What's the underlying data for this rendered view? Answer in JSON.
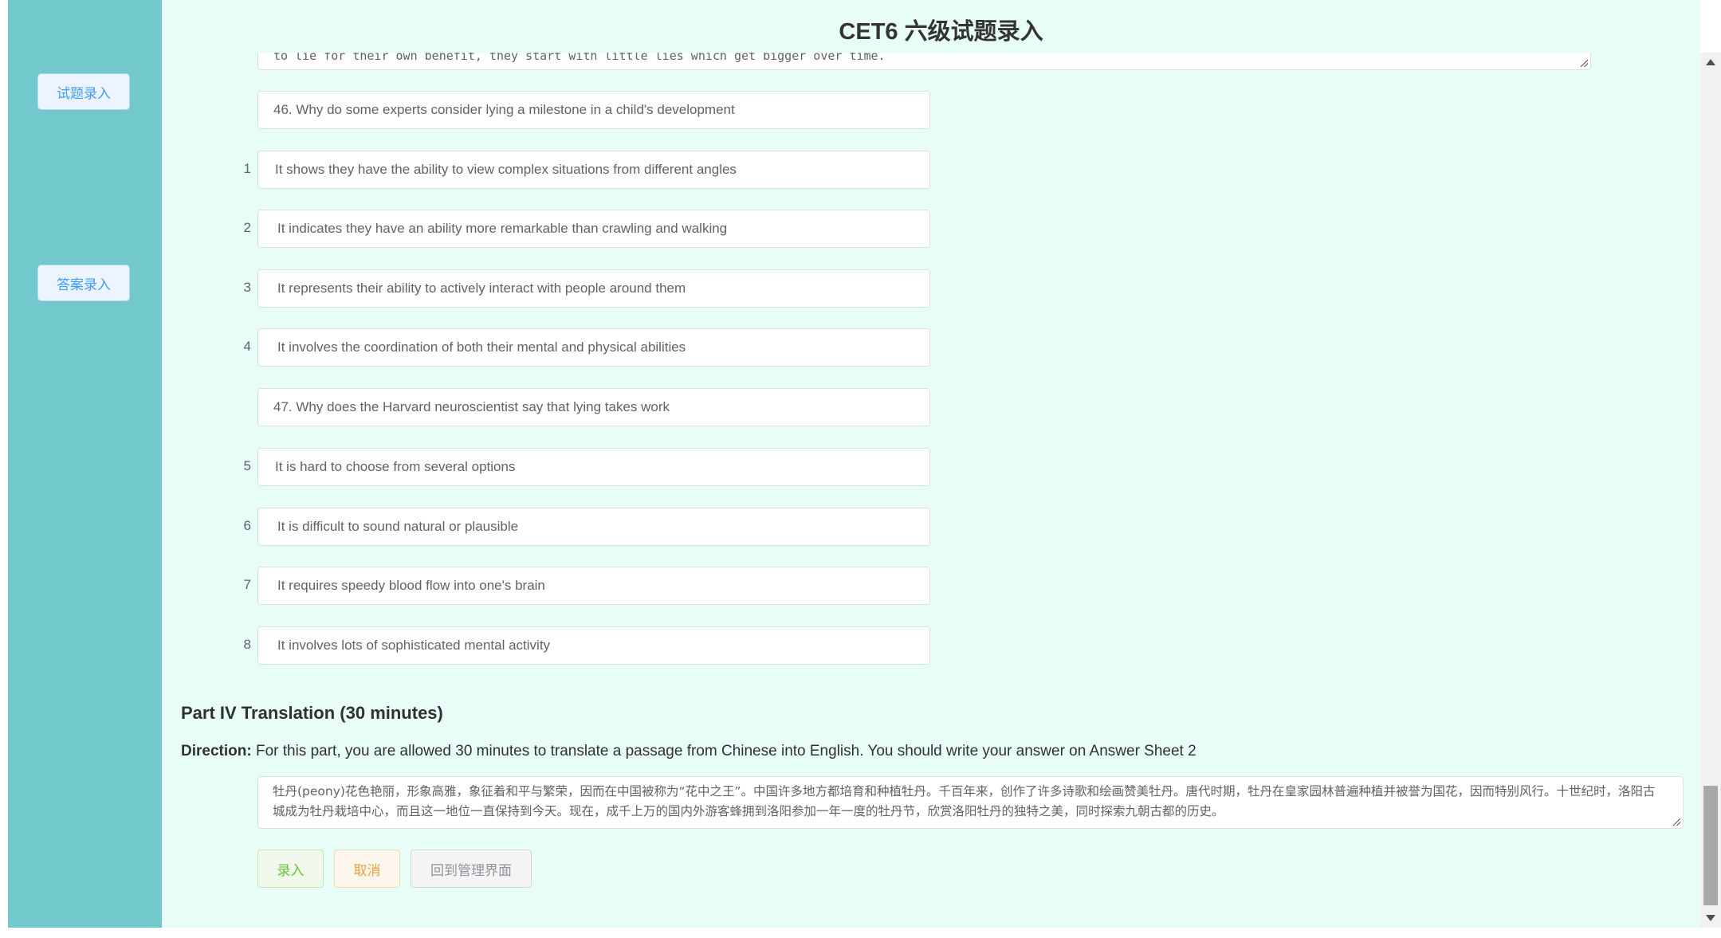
{
  "header": {
    "title": "CET6 六级试题录入"
  },
  "sidebar": {
    "items": [
      {
        "label": "试题录入"
      },
      {
        "label": "答案录入"
      }
    ]
  },
  "passage_textarea": {
    "visible_text": "to lie for their own benefit, they start with little lies which get bigger over time."
  },
  "questions": [
    {
      "question": "46. Why do some experts consider lying a milestone in a child's development",
      "options": [
        {
          "num": "1",
          "text": "It shows they have the ability to view complex situations from different angles"
        },
        {
          "num": "2",
          "text": "It indicates they have an ability more remarkable than crawling and walking"
        },
        {
          "num": "3",
          "text": "It represents their ability to actively interact with people around them"
        },
        {
          "num": "4",
          "text": "It involves the coordination of both their mental and physical abilities"
        }
      ]
    },
    {
      "question": "47. Why does the Harvard neuroscientist say that lying takes work",
      "options": [
        {
          "num": "5",
          "text": "It is hard to choose from several options"
        },
        {
          "num": "6",
          "text": "It is difficult to sound natural or plausible"
        },
        {
          "num": "7",
          "text": "It requires speedy blood flow into one's brain"
        },
        {
          "num": "8",
          "text": "It involves lots of sophisticated mental activity"
        }
      ]
    }
  ],
  "translation": {
    "part_title": "Part IV Translation (30 minutes)",
    "direction_label": "Direction:",
    "direction_text": " For this part, you are allowed 30 minutes to translate a passage from Chinese into English. You should write your answer on Answer Sheet 2",
    "passage": "牡丹(peony)花色艳丽，形象高雅，象征着和平与繁荣，因而在中国被称为“花中之王”。中国许多地方都培育和种植牡丹。千百年来，创作了许多诗歌和绘画赞美牡丹。唐代时期，牡丹在皇家园林普遍种植并被誉为国花，因而特别风行。十世纪时，洛阳古城成为牡丹栽培中心，而且这一地位一直保持到今天。现在，成千上万的国内外游客蜂拥到洛阳参加一年一度的牡丹节，欣赏洛阳牡丹的独特之美，同时探索九朝古都的历史。"
  },
  "buttons": {
    "submit": "录入",
    "cancel": "取消",
    "back": "回到管理界面"
  },
  "colors": {
    "sidebar_bg": "#72c9cb",
    "main_bg": "#e8fdf8",
    "accent_blue": "#409eff",
    "success_green": "#67c23a",
    "warning_orange": "#e6a23c",
    "info_gray": "#909399"
  }
}
